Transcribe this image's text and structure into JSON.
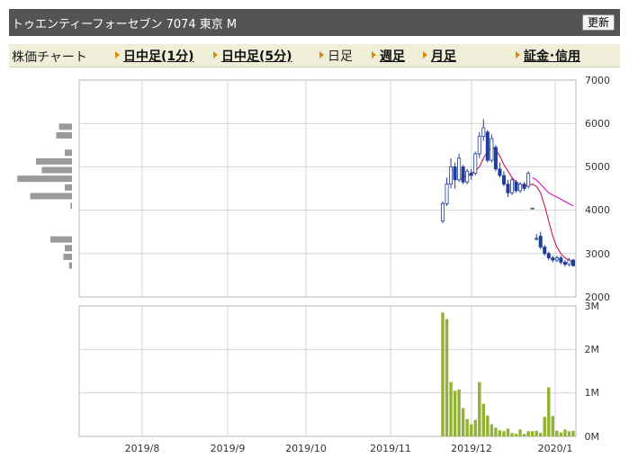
{
  "header": {
    "title": "トゥエンティーフォーセブン  7074  東京 M",
    "refresh_label": "更新"
  },
  "nav": {
    "label": "株価チャート",
    "items": [
      {
        "label": "日中足(1分)",
        "link": true
      },
      {
        "label": "日中足(5分)",
        "link": true
      },
      {
        "label": "日足",
        "link": false
      },
      {
        "label": "週足",
        "link": true
      },
      {
        "label": "月足",
        "link": true
      },
      {
        "label": "証金･信用",
        "link": true
      }
    ]
  },
  "chart_data": [
    {
      "type": "candlestick",
      "ylim": [
        2000,
        7000
      ],
      "y_ticks": [
        "7000",
        "6000",
        "5000",
        "4000",
        "3000",
        "2000"
      ],
      "x_ticks": [
        "2019/8",
        "2019/9",
        "2019/10",
        "2019/11",
        "2019/12",
        "2020/1"
      ],
      "colors": {
        "up": "#ffffff",
        "down": "#1f3d9a",
        "ma_short": "#c8003c",
        "ma_long": "#d100c8",
        "volume_profile": "#9a9a9a"
      },
      "candles": [
        {
          "o": 3750,
          "h": 4200,
          "l": 3700,
          "c": 4150
        },
        {
          "o": 4150,
          "h": 4750,
          "l": 4100,
          "c": 4600
        },
        {
          "o": 4600,
          "h": 5200,
          "l": 4500,
          "c": 5000
        },
        {
          "o": 5000,
          "h": 5100,
          "l": 4500,
          "c": 4700
        },
        {
          "o": 4700,
          "h": 5300,
          "l": 4650,
          "c": 5200
        },
        {
          "o": 5000,
          "h": 5050,
          "l": 4600,
          "c": 4650
        },
        {
          "o": 4650,
          "h": 4950,
          "l": 4600,
          "c": 4900
        },
        {
          "o": 4850,
          "h": 4950,
          "l": 4700,
          "c": 4800
        },
        {
          "o": 4850,
          "h": 5350,
          "l": 4800,
          "c": 5300
        },
        {
          "o": 5300,
          "h": 5800,
          "l": 5200,
          "c": 5700
        },
        {
          "o": 5700,
          "h": 6100,
          "l": 5600,
          "c": 5900
        },
        {
          "o": 5800,
          "h": 5850,
          "l": 5100,
          "c": 5150
        },
        {
          "o": 5150,
          "h": 5750,
          "l": 5100,
          "c": 5650
        },
        {
          "o": 5450,
          "h": 5500,
          "l": 4900,
          "c": 4950
        },
        {
          "o": 4950,
          "h": 5100,
          "l": 4750,
          "c": 4800
        },
        {
          "o": 4800,
          "h": 4900,
          "l": 4550,
          "c": 4600
        },
        {
          "o": 4600,
          "h": 4700,
          "l": 4300,
          "c": 4400
        },
        {
          "o": 4400,
          "h": 4750,
          "l": 4350,
          "c": 4700
        },
        {
          "o": 4650,
          "h": 4700,
          "l": 4400,
          "c": 4450
        },
        {
          "o": 4450,
          "h": 4650,
          "l": 4400,
          "c": 4600
        },
        {
          "o": 4600,
          "h": 4650,
          "l": 4450,
          "c": 4500
        },
        {
          "o": 4550,
          "h": 4900,
          "l": 4500,
          "c": 4850
        },
        {
          "o": 4050,
          "h": 4050,
          "l": 4050,
          "c": 4050
        },
        {
          "o": 3350,
          "h": 3450,
          "l": 3300,
          "c": 3350
        },
        {
          "o": 3400,
          "h": 3500,
          "l": 3100,
          "c": 3150
        },
        {
          "o": 3150,
          "h": 3200,
          "l": 2950,
          "c": 3000
        },
        {
          "o": 3000,
          "h": 3050,
          "l": 2850,
          "c": 2900
        },
        {
          "o": 2900,
          "h": 2950,
          "l": 2800,
          "c": 2850
        },
        {
          "o": 2850,
          "h": 2950,
          "l": 2800,
          "c": 2900
        },
        {
          "o": 2900,
          "h": 2950,
          "l": 2750,
          "c": 2800
        },
        {
          "o": 2800,
          "h": 2850,
          "l": 2700,
          "c": 2750
        },
        {
          "o": 2750,
          "h": 2900,
          "l": 2700,
          "c": 2850
        },
        {
          "o": 2850,
          "h": 2880,
          "l": 2700,
          "c": 2720
        }
      ],
      "ma_short": [
        null,
        null,
        null,
        null,
        4700,
        4750,
        4800,
        4850,
        4900,
        5000,
        5200,
        5350,
        5450,
        5400,
        5250,
        5050,
        4900,
        4750,
        4650,
        4580,
        4550,
        4580,
        4600,
        4550,
        4400,
        4100,
        3750,
        3400,
        3150,
        3000,
        2900,
        2850,
        2800
      ],
      "ma_long": [
        null,
        null,
        null,
        null,
        null,
        null,
        null,
        null,
        null,
        null,
        null,
        null,
        null,
        null,
        null,
        null,
        null,
        null,
        null,
        null,
        null,
        null,
        4750,
        4700,
        4600,
        4500,
        4400,
        4350,
        4300,
        4250,
        4200,
        4150,
        4100
      ],
      "volume_profile": [
        {
          "price": 5925,
          "size": 0.18
        },
        {
          "price": 5725,
          "size": 0.22
        },
        {
          "price": 5325,
          "size": 0.1
        },
        {
          "price": 5125,
          "size": 0.5
        },
        {
          "price": 4925,
          "size": 0.42
        },
        {
          "price": 4725,
          "size": 0.76
        },
        {
          "price": 4525,
          "size": 0.1
        },
        {
          "price": 4325,
          "size": 0.58
        },
        {
          "price": 4100,
          "size": 0.02
        },
        {
          "price": 3325,
          "size": 0.3
        },
        {
          "price": 3125,
          "size": 0.1
        },
        {
          "price": 2925,
          "size": 0.12
        },
        {
          "price": 2725,
          "size": 0.04
        }
      ]
    },
    {
      "type": "bar",
      "ylim": [
        0,
        3000000
      ],
      "y_ticks": [
        "3M",
        "2M",
        "1M",
        "0M"
      ],
      "x_ticks": [
        "2019/8",
        "2019/9",
        "2019/10",
        "2019/11",
        "2019/12",
        "2020/1"
      ],
      "color": "#93b232",
      "values": [
        2850000,
        2700000,
        1250000,
        1050000,
        1080000,
        650000,
        400000,
        280000,
        380000,
        1250000,
        750000,
        480000,
        280000,
        200000,
        140000,
        120000,
        180000,
        80000,
        60000,
        160000,
        60000,
        120000,
        120000,
        130000,
        80000,
        450000,
        1130000,
        470000,
        130000,
        90000,
        160000,
        120000,
        130000
      ]
    }
  ]
}
